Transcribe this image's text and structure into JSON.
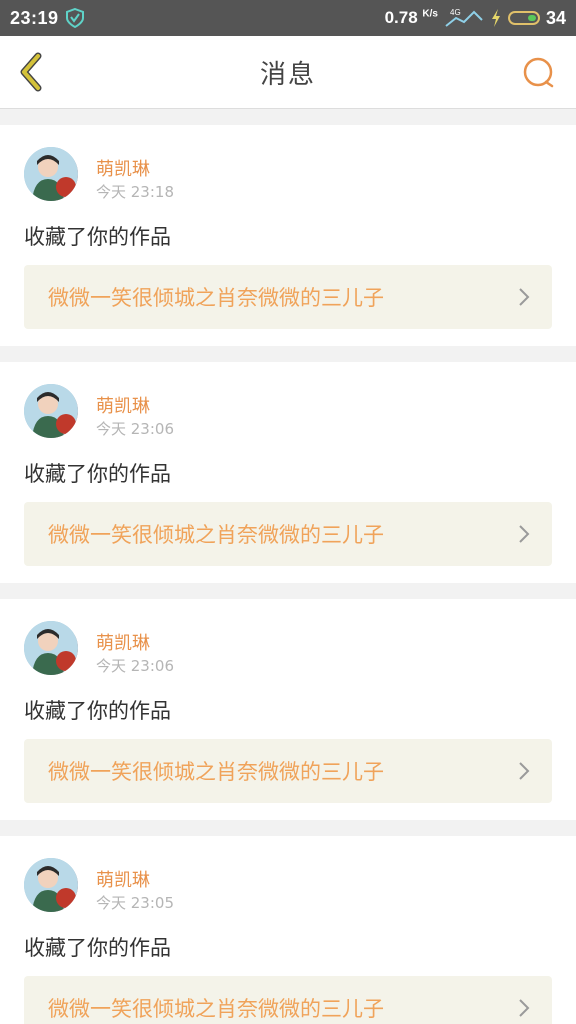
{
  "status_bar": {
    "time": "23:19",
    "net_speed": "0.78",
    "net_unit": "K/s",
    "network_type": "4G",
    "battery": "34"
  },
  "header": {
    "title": "消息"
  },
  "colors": {
    "accent": "#e8914a",
    "back_arrow": "#d4c23a",
    "card_bg": "#f4f3e9",
    "link_text": "#f0a35a"
  },
  "messages": [
    {
      "username": "萌凯琳",
      "time": "今天 23:18",
      "action": "收藏了你的作品",
      "work_title": "微微一笑很倾城之肖奈微微的三儿子"
    },
    {
      "username": "萌凯琳",
      "time": "今天 23:06",
      "action": "收藏了你的作品",
      "work_title": "微微一笑很倾城之肖奈微微的三儿子"
    },
    {
      "username": "萌凯琳",
      "time": "今天 23:06",
      "action": "收藏了你的作品",
      "work_title": "微微一笑很倾城之肖奈微微的三儿子"
    },
    {
      "username": "萌凯琳",
      "time": "今天 23:05",
      "action": "收藏了你的作品",
      "work_title": "微微一笑很倾城之肖奈微微的三儿子"
    }
  ]
}
